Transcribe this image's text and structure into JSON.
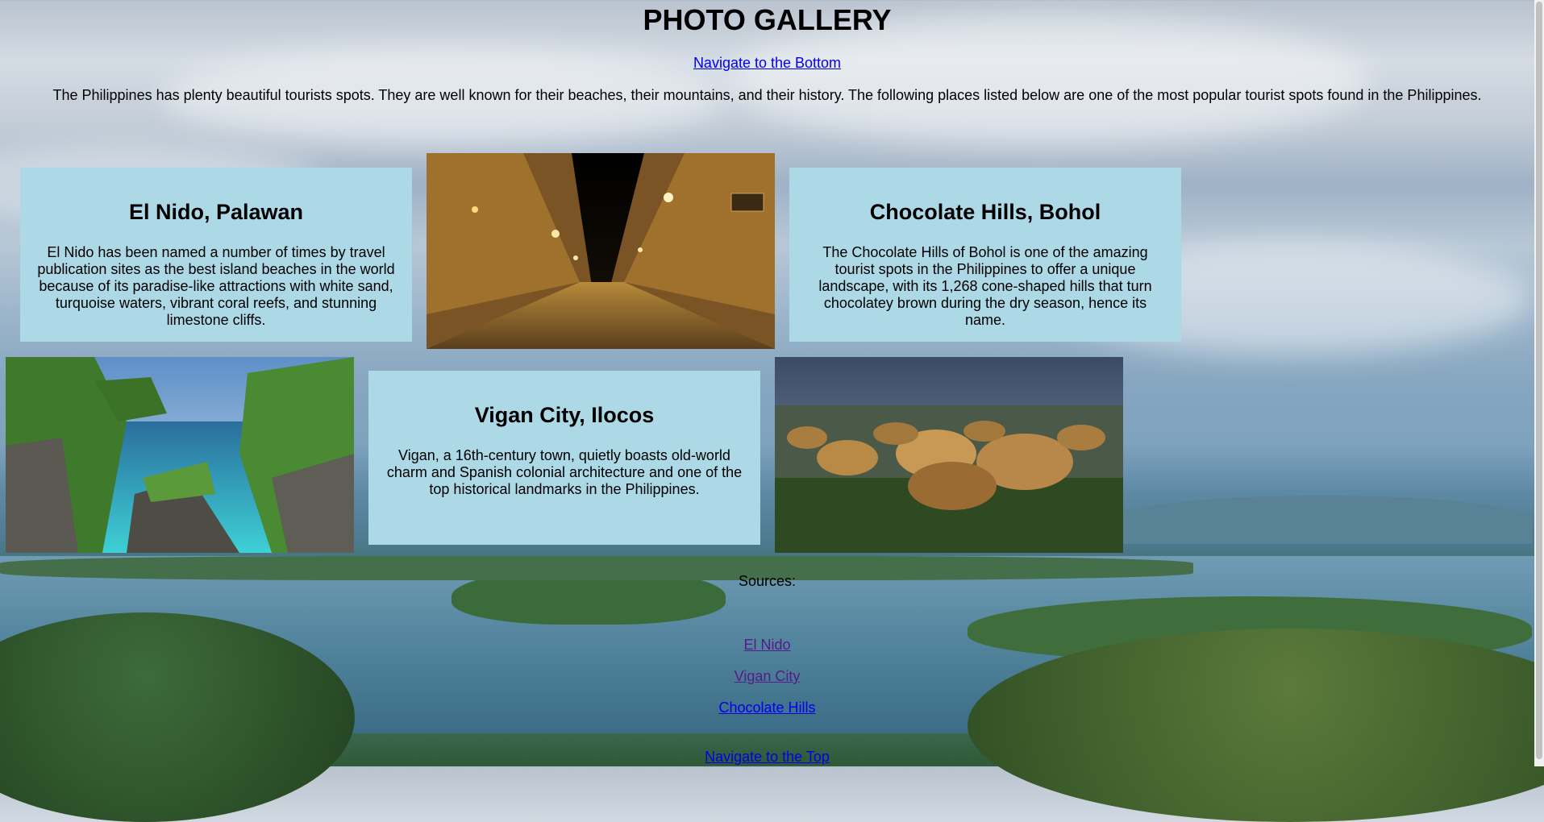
{
  "page": {
    "title": "PHOTO GALLERY",
    "nav_bottom": "Navigate to the Bottom",
    "intro": "The Philippines has plenty beautiful tourists spots. They are well known for their beaches, their mountains, and their history. The following places listed below are one of the most popular tourist spots found in the Philippines."
  },
  "cards": {
    "elnido": {
      "title": "El Nido, Palawan",
      "text": "El Nido has been named a number of times by travel publication sites as the best island beaches in the world because of its paradise-like attractions with white sand, turquoise waters, vibrant coral reefs, and stunning limestone cliffs."
    },
    "chocolate": {
      "title": "Chocolate Hills, Bohol",
      "text": "The Chocolate Hills of Bohol is one of the amazing tourist spots in the Philippines to offer a unique landscape, with its 1,268 cone-shaped hills that turn chocolatey brown during the dry season, hence its name."
    },
    "vigan": {
      "title": "Vigan City, Ilocos",
      "text": "Vigan, a 16th-century town, quietly boasts old-world charm and Spanish colonial architecture and one of the top historical landmarks in the Philippines."
    }
  },
  "sources": {
    "label": "Sources:",
    "links": [
      "El Nido",
      "Vigan City",
      "Chocolate Hills"
    ],
    "nav_top": "Navigate to the Top"
  },
  "colors": {
    "card_bg": "#add8e6",
    "link": "#0000ee",
    "visited_link": "#551a8b"
  }
}
